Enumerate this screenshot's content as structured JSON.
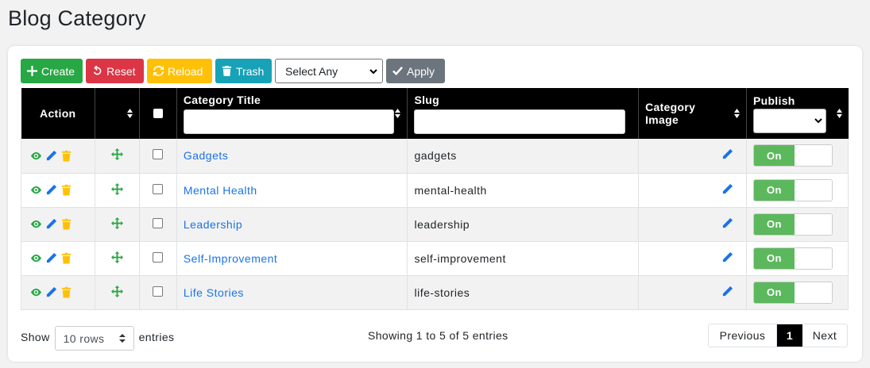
{
  "page": {
    "title": "Blog Category"
  },
  "toolbar": {
    "create": "Create",
    "reset": "Reset",
    "reload": "Reload",
    "trash": "Trash",
    "select_value": "Select Any",
    "apply": "Apply"
  },
  "table": {
    "headers": {
      "action": "Action",
      "category_title": "Category Title",
      "slug": "Slug",
      "category_image_1": "Category",
      "category_image_2": "Image",
      "publish": "Publish"
    },
    "rows": [
      {
        "title": "Gadgets",
        "slug": "gadgets",
        "status": "On"
      },
      {
        "title": "Mental Health",
        "slug": "mental-health",
        "status": "On"
      },
      {
        "title": "Leadership",
        "slug": "leadership",
        "status": "On"
      },
      {
        "title": "Self-Improvement",
        "slug": "self-improvement",
        "status": "On"
      },
      {
        "title": "Life Stories",
        "slug": "life-stories",
        "status": "On"
      }
    ]
  },
  "footer": {
    "show": "Show",
    "rows_value": "10 rows",
    "entries": "entries",
    "info": "Showing 1 to 5 of 5 entries",
    "prev": "Previous",
    "page": "1",
    "next": "Next"
  },
  "colors": {
    "create": "#28a745",
    "reset": "#dc3545",
    "reload": "#ffc107",
    "trash": "#17a2b8",
    "apply": "#6c757d",
    "link": "#1a73e8",
    "view_icon": "#28a745",
    "edit_icon": "#1a73e8",
    "delete_icon": "#ffc107",
    "toggle_on": "#5cb85c"
  },
  "icons": [
    "plus-icon",
    "undo-icon",
    "refresh-icon",
    "trash-icon",
    "check-icon",
    "eye-icon",
    "pencil-icon",
    "trash-icon",
    "move-icon",
    "sort-icon",
    "chevron-down-icon"
  ]
}
